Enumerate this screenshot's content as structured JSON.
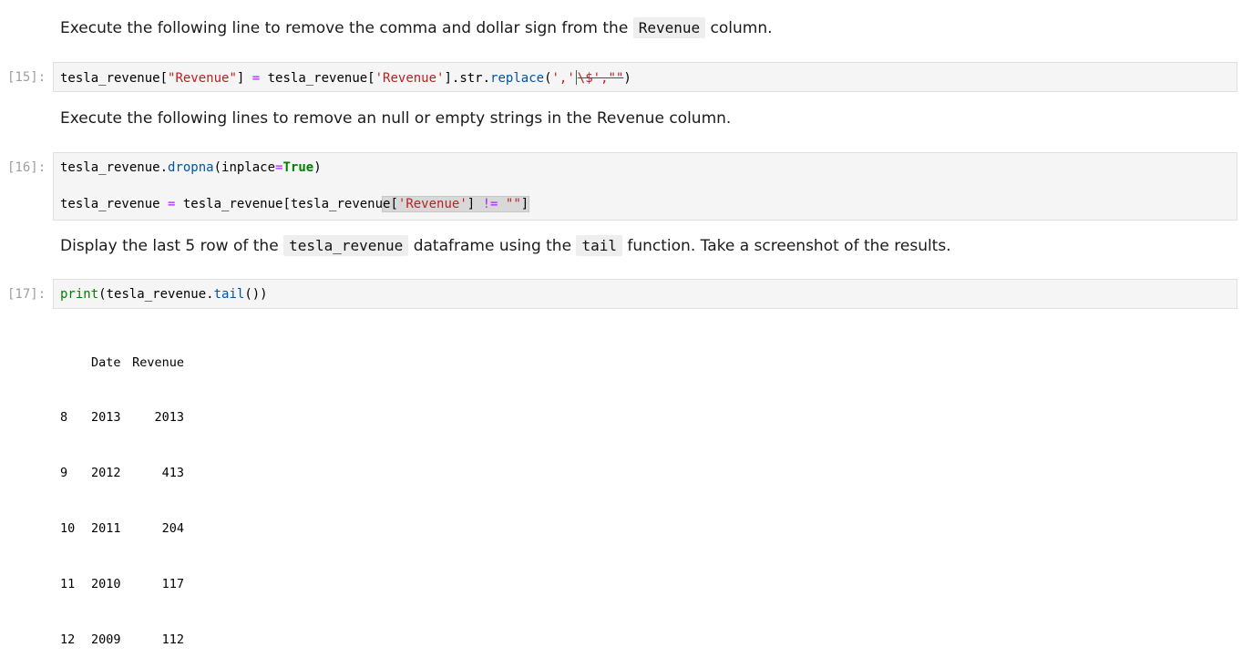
{
  "md1": {
    "pre": "Execute the following line to remove the comma and dollar sign from the ",
    "code": "Revenue",
    "post": " column."
  },
  "cell15": {
    "prompt": "[15]:"
  },
  "md2": {
    "text": "Execute the following lines to remove an null or empty strings in the Revenue column."
  },
  "cell16": {
    "prompt": "[16]:"
  },
  "md3": {
    "pre": "Display the last 5 row of the ",
    "code1": "tesla_revenue",
    "mid": " dataframe using the ",
    "code2": "tail",
    "post": " function. Take a screenshot of the results."
  },
  "cell17": {
    "prompt": "[17]:"
  },
  "output": {
    "header": {
      "date": "Date",
      "revenue": "Revenue"
    },
    "rows": [
      {
        "idx": "8",
        "date": "2013",
        "revenue": "2013"
      },
      {
        "idx": "9",
        "date": "2012",
        "revenue": "413"
      },
      {
        "idx": "10",
        "date": "2011",
        "revenue": "204"
      },
      {
        "idx": "11",
        "date": "2010",
        "revenue": "117"
      },
      {
        "idx": "12",
        "date": "2009",
        "revenue": "112"
      }
    ]
  }
}
